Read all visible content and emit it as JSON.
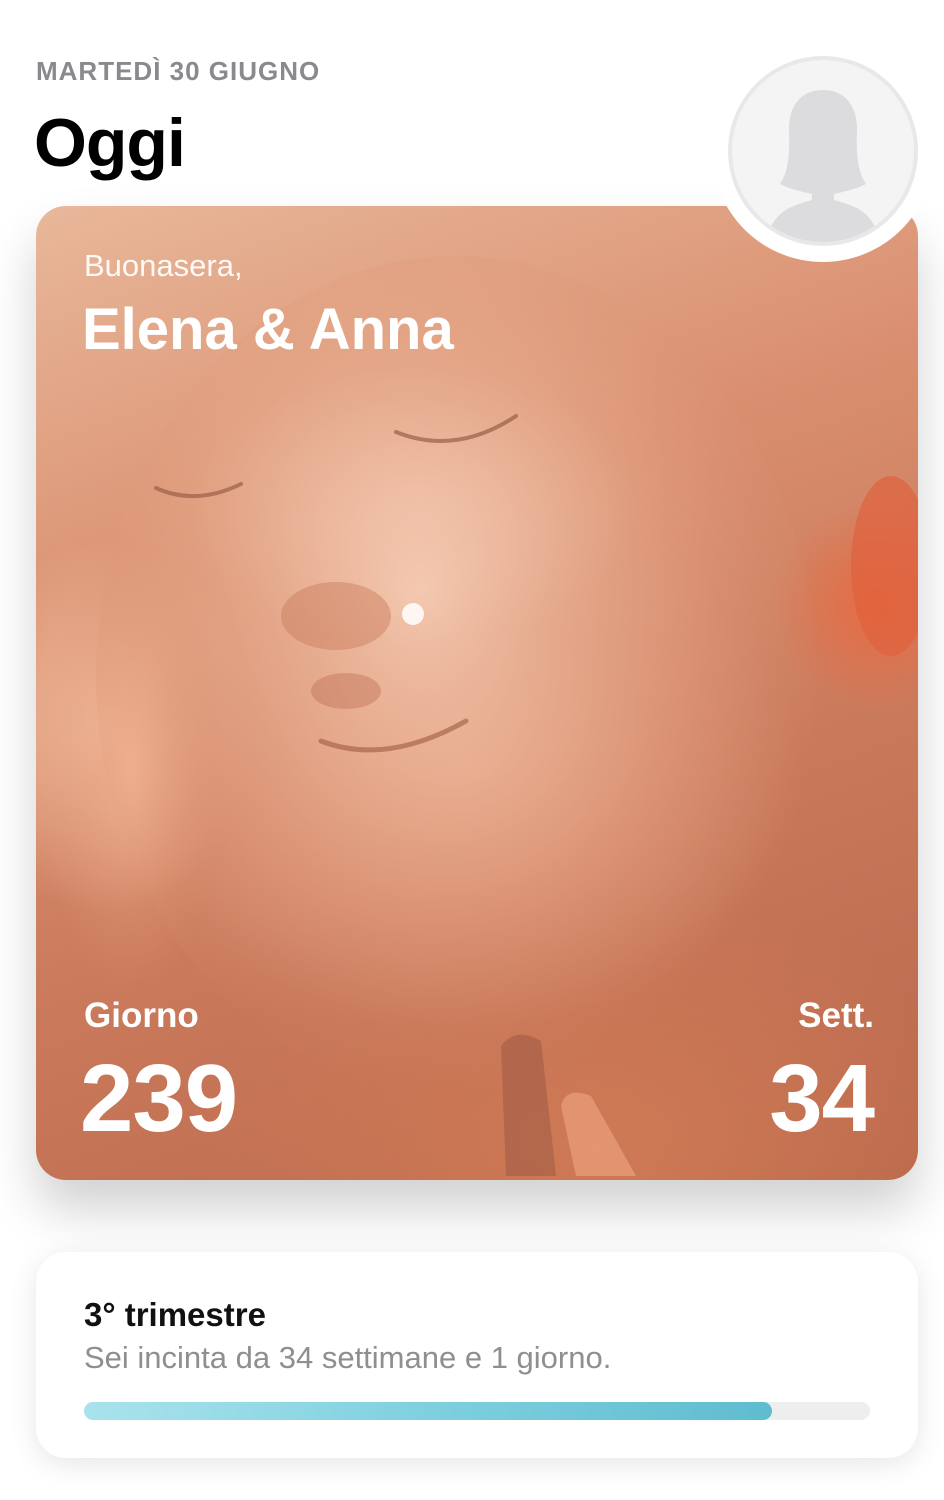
{
  "header": {
    "date": "MARTEDÌ 30 GIUGNO",
    "title": "Oggi"
  },
  "hero": {
    "greeting": "Buonasera,",
    "names": "Elena & Anna",
    "day_label": "Giorno",
    "day_value": "239",
    "week_label": "Sett.",
    "week_value": "34"
  },
  "profile": {
    "icon": "person-silhouette-icon"
  },
  "trimester": {
    "title": "3° trimestre",
    "subtitle": "Sei incinta da 34 settimane e 1 giorno.",
    "progress": 0.875,
    "colors": {
      "fill": "#7fd0df",
      "track": "#eeeeef"
    }
  }
}
